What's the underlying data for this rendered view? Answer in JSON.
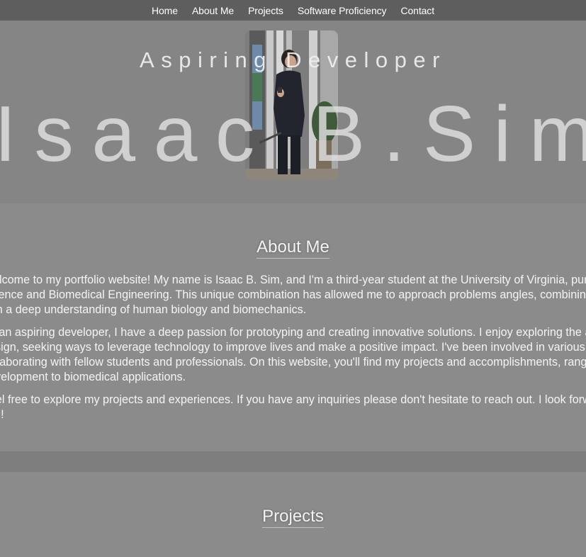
{
  "nav": {
    "items": [
      {
        "label": "Home"
      },
      {
        "label": "About Me"
      },
      {
        "label": "Projects"
      },
      {
        "label": "Software Proficiency"
      },
      {
        "label": "Contact"
      }
    ]
  },
  "hero": {
    "subtitle": "Aspiring Developer",
    "name": "Isaac B.Sim"
  },
  "about": {
    "heading": "About Me",
    "paragraphs": [
      "Welcome to my portfolio website! My name is Isaac B. Sim, and I'm a third-year student at the University of Virginia, pursuing in Computer Science and Biomedical Engineering. This unique combination has allowed me to approach problems angles, combining technical expertise with a deep understanding of human biology and biomechanics.",
      "As an aspiring developer, I have a deep passion for prototyping and creating innovative solutions. I enjoy exploring the and human-centered design, seeking ways to leverage technology to improve lives and make a positive impact. I've been involved in various hands-on projects, collaborating with fellow students and professionals. On this website, you'll find my projects and accomplishments, ranging from web development to biomedical applications.",
      "Feel free to explore my projects and experiences. If you have any inquiries please don't hesitate to reach out. I look forward to hearing from you!"
    ]
  },
  "projects": {
    "heading": "Projects"
  }
}
